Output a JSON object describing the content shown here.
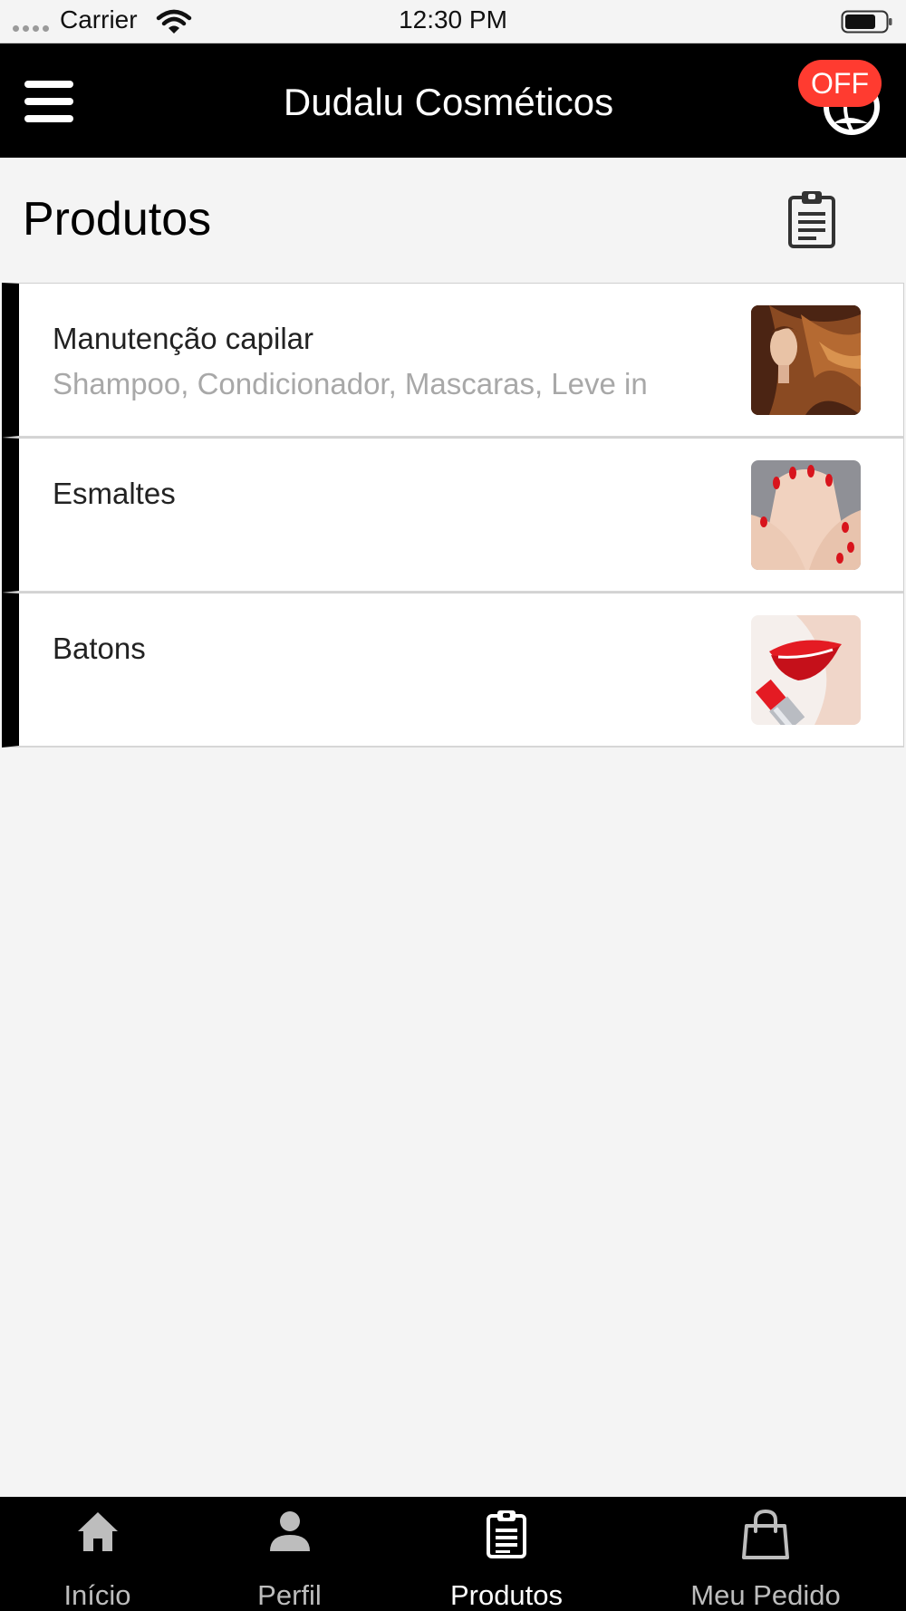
{
  "status_bar": {
    "carrier": "Carrier",
    "time": "12:30 PM"
  },
  "header": {
    "title": "Dudalu Cosméticos",
    "badge": "OFF",
    "badge_color": "#ff3b30"
  },
  "page": {
    "title": "Produtos"
  },
  "products": [
    {
      "name": "Manutenção capilar",
      "description": "Shampoo, Condicionador, Mascaras, Leve in",
      "image": "hair-photo"
    },
    {
      "name": "Esmaltes",
      "description": "",
      "image": "nails-photo"
    },
    {
      "name": "Batons",
      "description": "",
      "image": "lipstick-photo"
    }
  ],
  "tabs": [
    {
      "label": "Início",
      "icon": "home-icon",
      "active": false
    },
    {
      "label": "Perfil",
      "icon": "person-icon",
      "active": false
    },
    {
      "label": "Produtos",
      "icon": "clipboard-icon",
      "active": true
    },
    {
      "label": "Meu Pedido",
      "icon": "shopping-bag-icon",
      "active": false
    }
  ]
}
